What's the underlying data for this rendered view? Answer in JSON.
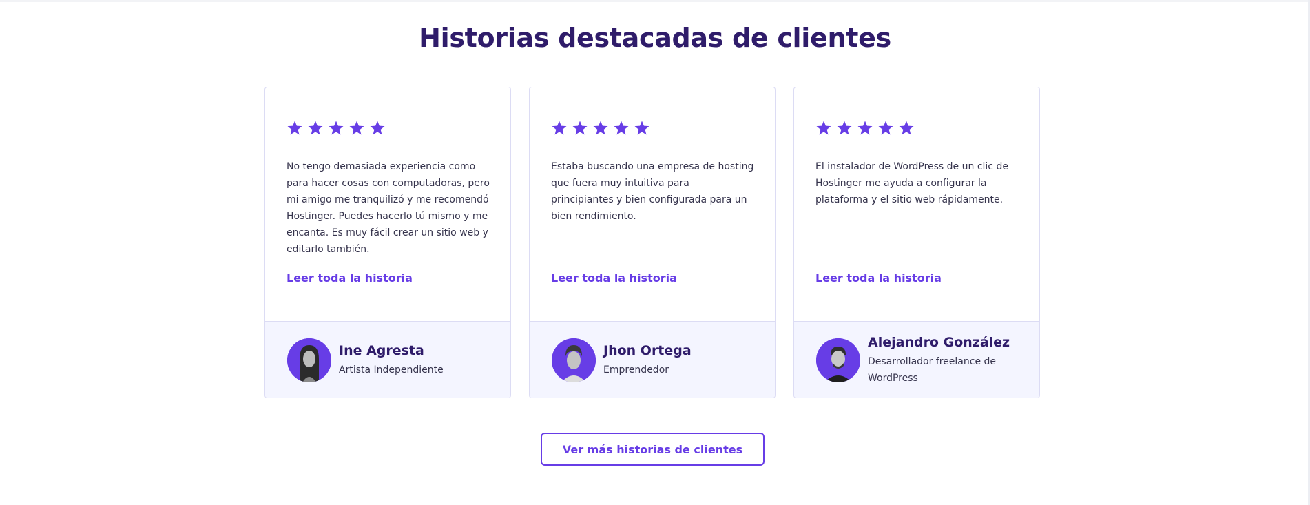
{
  "section": {
    "title": "Historias destacadas de clientes",
    "cta_label": "Ver más historias de clientes"
  },
  "colors": {
    "accent": "#673de6",
    "heading": "#2f1c6a",
    "body_text": "#36344d",
    "card_border": "#dcdcf4",
    "card_footer_bg": "#f4f5ff"
  },
  "testimonials": [
    {
      "rating": 5,
      "quote": "No tengo demasiada experiencia como para hacer cosas con computadoras, pero mi amigo me tranquilizó y me recomendó Hostinger. Puedes hacerlo tú mismo y me encanta. Es muy fácil crear un sitio web y editarlo también.",
      "link_label": "Leer toda la historia",
      "author_name": "Ine Agresta",
      "author_role": "Artista Independiente"
    },
    {
      "rating": 5,
      "quote": "Estaba buscando una empresa de hosting que fuera muy intuitiva para principiantes y bien configurada para un bien rendimiento.",
      "link_label": "Leer toda la historia",
      "author_name": "Jhon Ortega",
      "author_role": "Emprendedor"
    },
    {
      "rating": 5,
      "quote": "El instalador de WordPress de un clic de Hostinger me ayuda a configurar la plataforma y el sitio web rápidamente.",
      "link_label": "Leer toda la historia",
      "author_name": "Alejandro González",
      "author_role": "Desarrollador freelance de WordPress"
    }
  ]
}
